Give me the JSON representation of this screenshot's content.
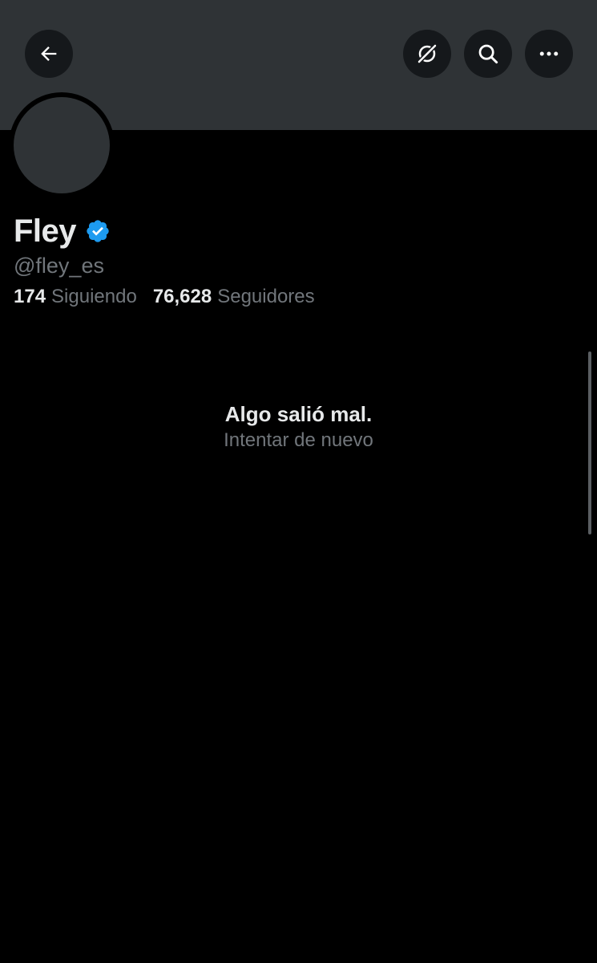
{
  "header": {
    "back_icon": "arrow-left-icon",
    "grok_icon": "grok-slash-icon",
    "search_icon": "search-icon",
    "more_icon": "more-horizontal-icon"
  },
  "profile": {
    "display_name": "Fley",
    "verified_badge": "verified-check-icon",
    "handle": "@fley_es",
    "following_count": "174",
    "following_label": "Siguiendo",
    "followers_count": "76,628",
    "followers_label": "Seguidores"
  },
  "error": {
    "title": "Algo salió mal.",
    "retry": "Intentar de nuevo"
  },
  "colors": {
    "background": "#000000",
    "banner": "#2f3336",
    "button_bg": "#15181b",
    "primary_text": "#e7e9ea",
    "secondary_text": "#71767b",
    "verified_blue": "#1d9bf0"
  }
}
